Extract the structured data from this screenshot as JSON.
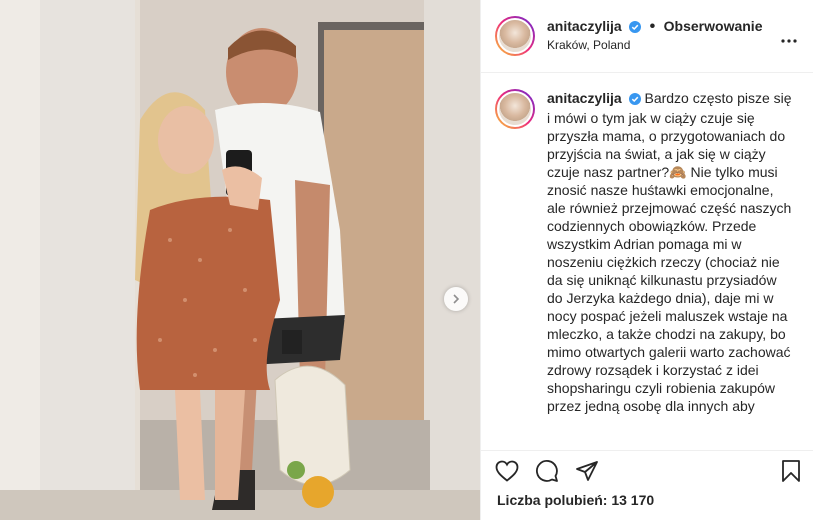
{
  "header": {
    "username": "anitaczylija",
    "separator": "•",
    "follow_label": "Obserwowanie",
    "location": "Kraków, Poland",
    "verified_icon": "verified-badge-icon",
    "more_icon": "more-options-icon"
  },
  "caption": {
    "username": "anitaczylija",
    "text": "Bardzo często pisze się i mówi o tym jak w ciąży czuje się przyszła mama, o przygotowaniach do przyjścia na świat, a jak się w ciąży czuje nasz partner?🙈 Nie tylko musi znosić nasze huśtawki emocjonalne, ale również przejmować część naszych codziennych obowiązków. Przede wszystkim Adrian pomaga mi w noszeniu ciężkich rzeczy (chociaż nie da się uniknąć kilkunastu przysiadów do Jerzyka każdego dnia), daje mi w nocy pospać jeżeli maluszek wstaje na mleczko, a także chodzi na zakupy, bo mimo otwartych galerii warto zachować zdrowy rozsądek i korzystać z idei shopsharingu czyli robienia zakupów przez jedną osobę dla innych aby"
  },
  "actions": {
    "like_icon": "heart-icon",
    "comment_icon": "comment-icon",
    "share_icon": "share-icon",
    "save_icon": "bookmark-icon"
  },
  "likes": {
    "text": "Liczba polubień: 13 170"
  },
  "photo": {
    "alt": "couple mirror selfie",
    "next_icon": "chevron-right-icon"
  },
  "colors": {
    "verified": "#3897f0",
    "border": "#efefef",
    "text": "#262626"
  }
}
